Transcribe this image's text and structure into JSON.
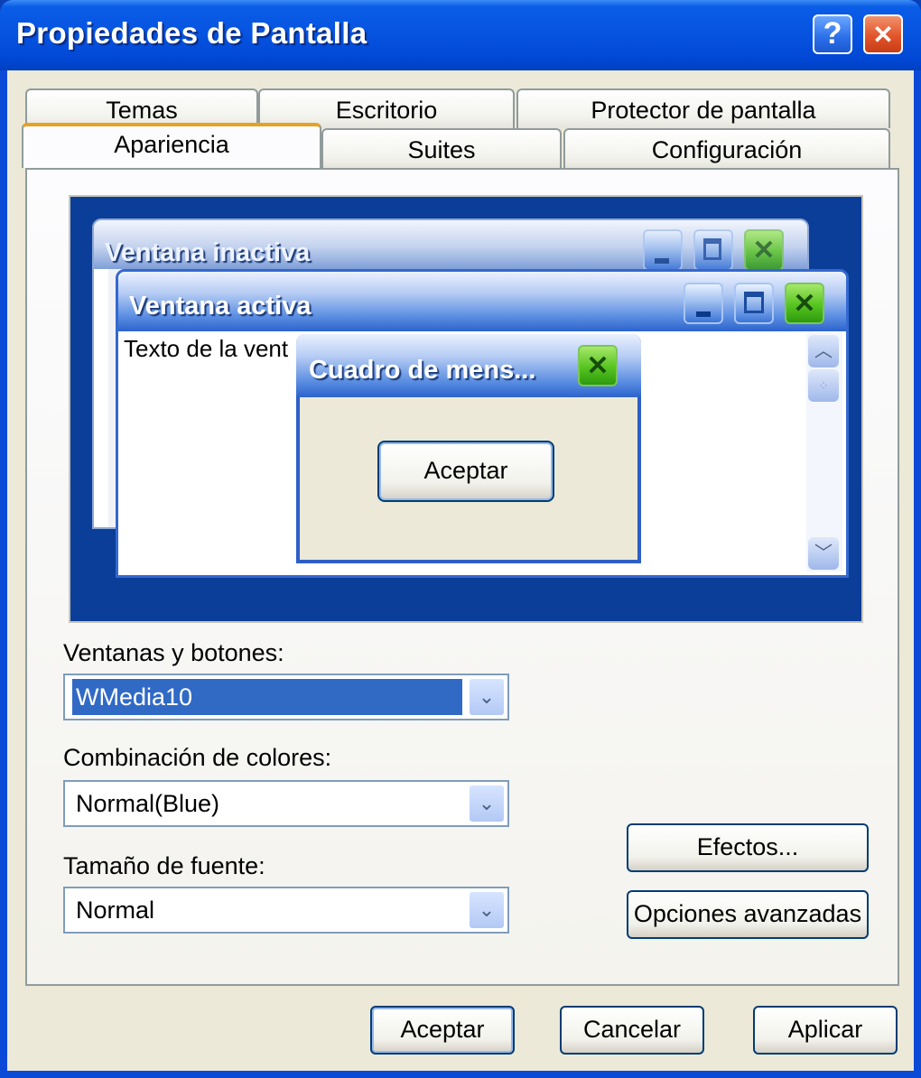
{
  "window": {
    "title": "Propiedades de Pantalla",
    "help_glyph": "?",
    "close_glyph": "✕"
  },
  "tabs": {
    "row1": [
      {
        "label": "Temas"
      },
      {
        "label": "Escritorio"
      },
      {
        "label": "Protector de pantalla"
      }
    ],
    "row2": [
      {
        "label": "Apariencia",
        "active": true
      },
      {
        "label": "Suites"
      },
      {
        "label": "Configuración"
      }
    ]
  },
  "preview": {
    "inactive_title": "Ventana inactiva",
    "active_title": "Ventana activa",
    "window_text": "Texto de la vent",
    "message_title": "Cuadro de mens...",
    "message_button": "Aceptar",
    "icons": {
      "minimize": "minimize-icon",
      "maximize": "maximize-icon",
      "close": "close-icon",
      "scroll_up": "chevron-up-icon",
      "scroll_down": "chevron-down-icon"
    }
  },
  "form": {
    "windows_buttons": {
      "label": "Ventanas y botones:",
      "value": "WMedia10"
    },
    "color_scheme": {
      "label": "Combinación de colores:",
      "value": "Normal(Blue)"
    },
    "font_size": {
      "label": "Tamaño de fuente:",
      "value": "Normal"
    },
    "arrow_glyph": "⌄"
  },
  "side_buttons": {
    "effects": "Efectos...",
    "advanced": "Opciones avanzadas"
  },
  "footer": {
    "ok": "Aceptar",
    "cancel": "Cancelar",
    "apply": "Aplicar"
  }
}
